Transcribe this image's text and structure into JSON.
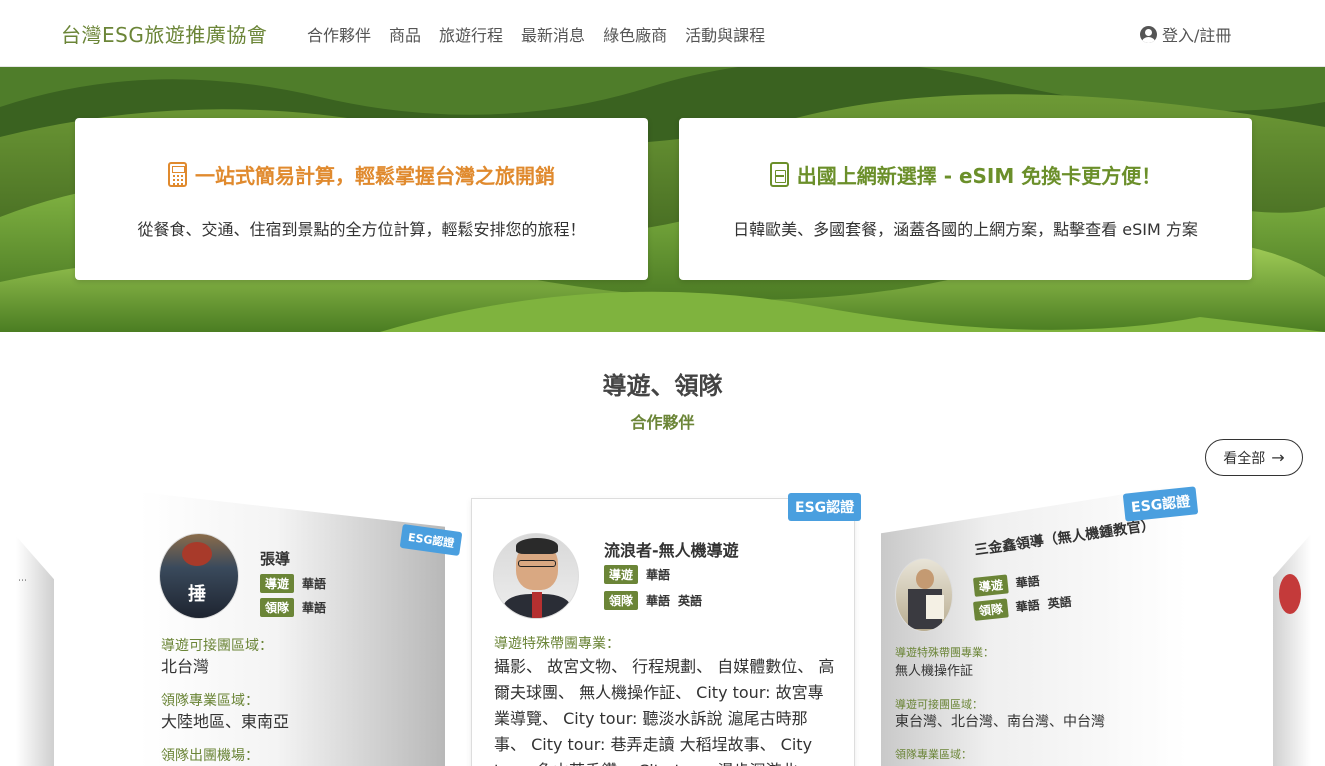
{
  "nav": {
    "brand": "台灣ESG旅遊推廣協會",
    "links": [
      "合作夥伴",
      "商品",
      "旅遊行程",
      "最新消息",
      "綠色廠商",
      "活動與課程"
    ],
    "login": "登入/註冊"
  },
  "promos": [
    {
      "title": "一站式簡易計算，輕鬆掌握台灣之旅開銷",
      "desc": "從餐食、交通、住宿到景點的全方位計算，輕鬆安排您的旅程！",
      "icon": "calculator-icon",
      "color": "#e08a2e"
    },
    {
      "title": "出國上網新選擇 - eSIM 免換卡更方便！",
      "desc": "日韓歐美、多國套餐，涵蓋各國的上網方案，點擊查看 eSIM 方案",
      "icon": "sim-card-icon",
      "color": "#6b8f2a"
    }
  ],
  "section": {
    "title": "導遊、領隊",
    "subtitle": "合作夥伴",
    "view_all": "看全部"
  },
  "guides": {
    "left": {
      "badge": "ESG認證",
      "name": "張導",
      "role1": "導遊",
      "lang1": "華語",
      "role2": "領隊",
      "lang2": "華語",
      "f1_label": "導遊可接團區域：",
      "f1_value": "北台灣",
      "f2_label": "領隊專業區域：",
      "f2_value": "大陸地區、東南亞",
      "f3_label": "領隊出團機場："
    },
    "center": {
      "badge": "ESG認證",
      "name": "流浪者-無人機導遊",
      "role1": "導遊",
      "lang1": "華語",
      "role2": "領隊",
      "lang2a": "華語",
      "lang2b": "英語",
      "f1_label": "導遊特殊帶團專業：",
      "f1_value": "攝影、 故宮文物、 行程規劃、 自媒體數位、 高爾夫球團、 無人機操作証、 City tour: 故宮專業導覽、 City tour: 聽淡水訴說 滬尾古時那事、 City tour: 巷弄走讀 大稻埕故事、 City tour: 象山茶香鑽、 City tour: 漫步深游北"
    },
    "right": {
      "badge": "ESG認證",
      "name": "三金鑫領導（無人機鍾教官）",
      "role1": "導遊",
      "lang1": "華語",
      "role2": "領隊",
      "lang2a": "華語",
      "lang2b": "英語",
      "f1_label": "導遊特殊帶團專業：",
      "f1_value": "無人機操作証",
      "f2_label": "導遊可接團區域：",
      "f2_value": "東台灣、北台灣、南台灣、中台灣",
      "f3_label": "領隊專業區域："
    }
  }
}
